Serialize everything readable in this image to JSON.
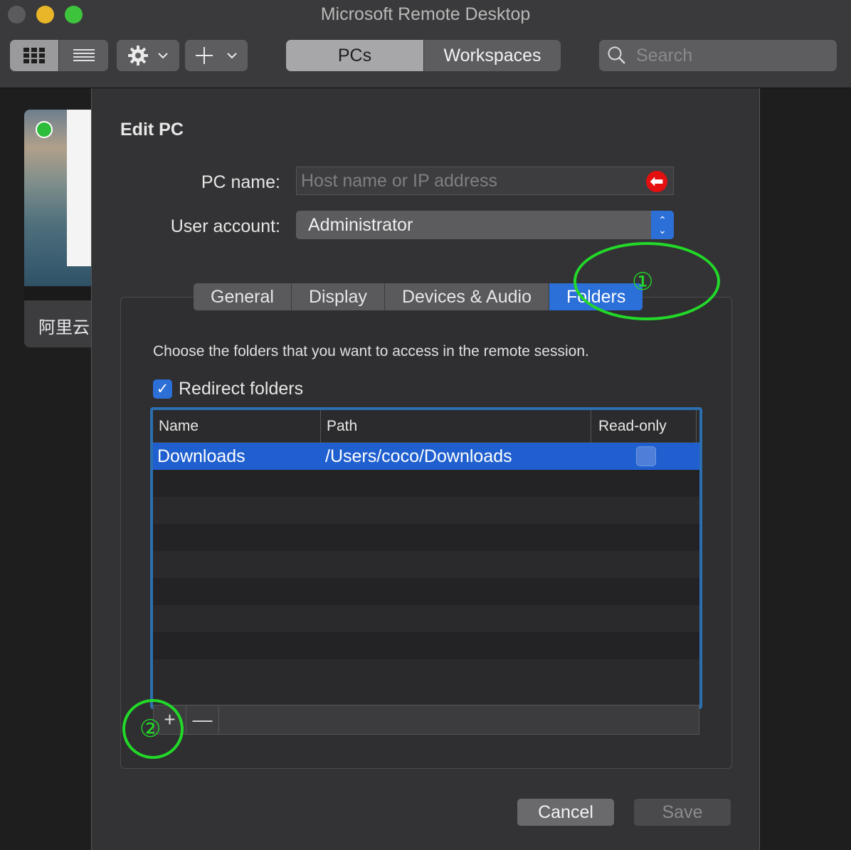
{
  "window": {
    "title": "Microsoft Remote Desktop"
  },
  "toolbar": {
    "view_icons": [
      "grid-icon",
      "list-icon"
    ],
    "settings_icon": "gear-icon",
    "add_icon": "plus-icon",
    "tabs": [
      "PCs",
      "Workspaces"
    ],
    "active_tab": "PCs",
    "search_placeholder": "Search"
  },
  "tile": {
    "label": "阿里云"
  },
  "dialog": {
    "title": "Edit PC",
    "pc_name_label": "PC name:",
    "pc_name_placeholder": "Host name or IP address",
    "user_account_label": "User account:",
    "user_account_value": "Administrator",
    "tabs": [
      "General",
      "Display",
      "Devices & Audio",
      "Folders"
    ],
    "active_tab": "Folders",
    "folders": {
      "description": "Choose the folders that you want to access in the remote session.",
      "redirect_label": "Redirect folders",
      "redirect_checked": true,
      "columns": [
        "Name",
        "Path",
        "Read-only"
      ],
      "rows": [
        {
          "name": "Downloads",
          "path": "/Users/coco/Downloads",
          "read_only": false
        }
      ],
      "add_symbol": "+",
      "remove_symbol": "—"
    },
    "cancel_label": "Cancel",
    "save_label": "Save"
  },
  "annotations": {
    "marker_1": "①",
    "marker_2": "②"
  },
  "colors": {
    "accent": "#2b6fd8",
    "annotation": "#22d828",
    "warning": "#e40f0f"
  }
}
